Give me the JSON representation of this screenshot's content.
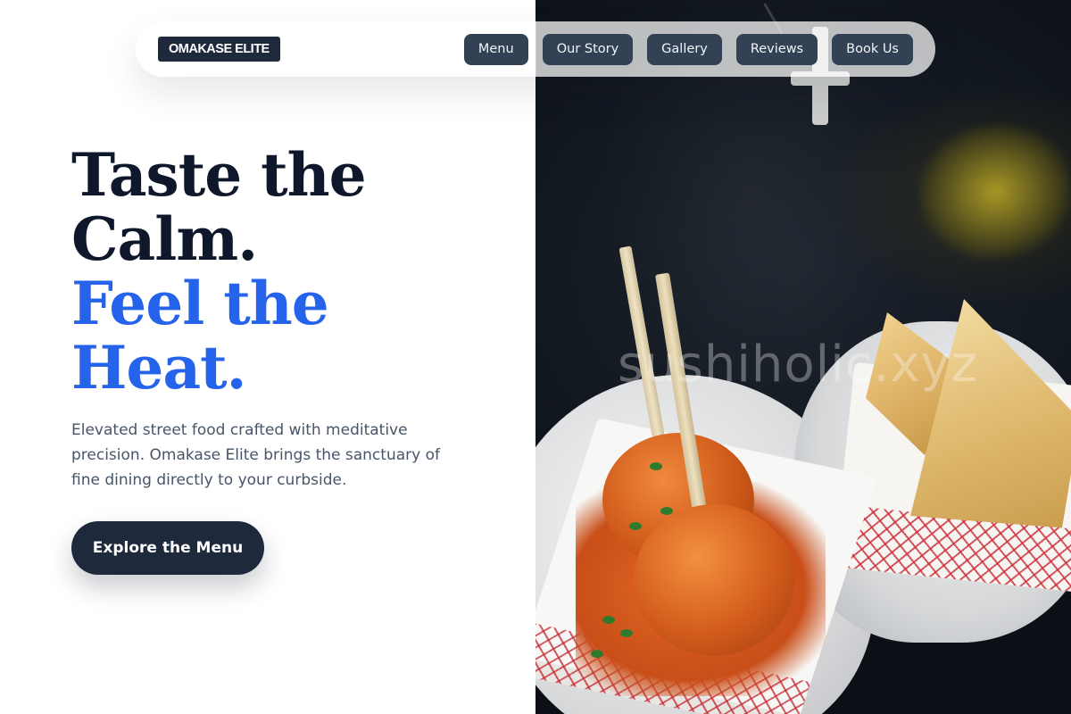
{
  "brand": {
    "logo_text": "OMAKASE ELITE"
  },
  "nav": {
    "links": [
      {
        "label": "Menu"
      },
      {
        "label": "Our Story"
      },
      {
        "label": "Gallery"
      },
      {
        "label": "Reviews"
      },
      {
        "label": "Book Us"
      }
    ]
  },
  "hero": {
    "headline_dark": [
      "Taste the",
      "Calm."
    ],
    "headline_accent": [
      "Feel the",
      "Heat."
    ],
    "description": "Elevated street food crafted with meditative precision. Omakase Elite brings the sanctuary of fine dining directly to your curbside.",
    "cta_label": "Explore the Menu"
  },
  "image": {
    "watermark": "sushiholic.xyz"
  },
  "colors": {
    "ink": "#0f172a",
    "accent": "#2563eb",
    "button": "#1e293b",
    "nav_button": "#334155",
    "body_text": "#475569"
  }
}
